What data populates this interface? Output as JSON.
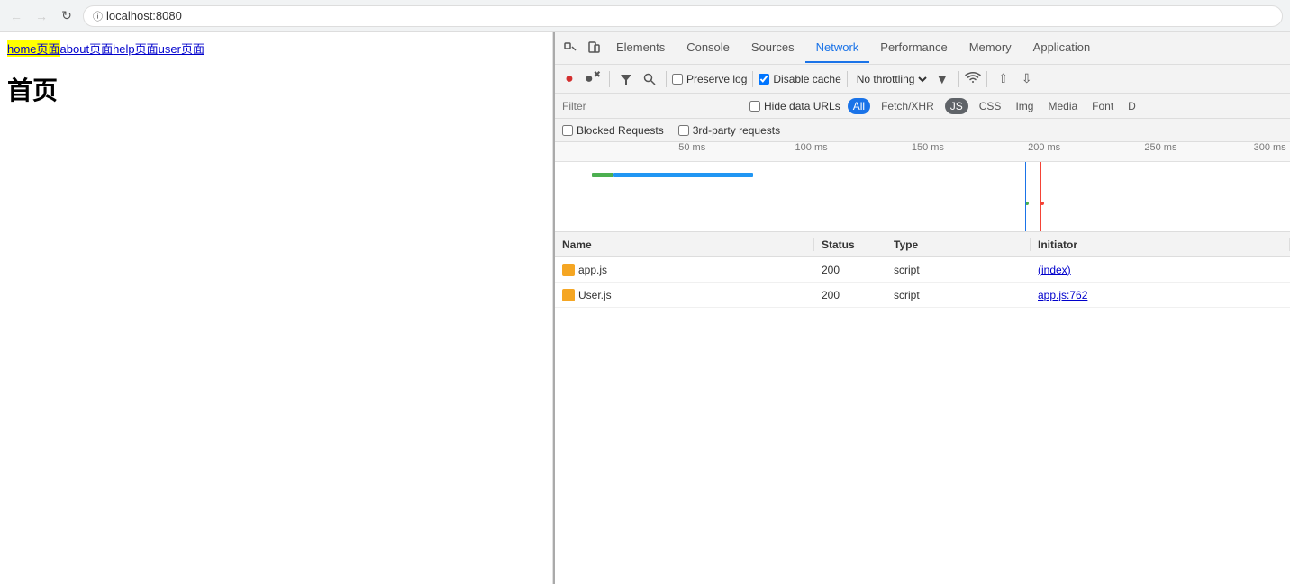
{
  "browser": {
    "address": "localhost:8080"
  },
  "page": {
    "nav_links": [
      {
        "label": "home页面",
        "highlighted": true
      },
      {
        "label": "about页面",
        "highlighted": false
      },
      {
        "label": "help页面",
        "highlighted": false
      },
      {
        "label": "user页面",
        "highlighted": false
      }
    ],
    "heading": "首页"
  },
  "devtools": {
    "tabs": [
      {
        "label": "Elements",
        "active": false
      },
      {
        "label": "Console",
        "active": false
      },
      {
        "label": "Sources",
        "active": false
      },
      {
        "label": "Network",
        "active": true
      },
      {
        "label": "Performance",
        "active": false
      },
      {
        "label": "Memory",
        "active": false
      },
      {
        "label": "Application",
        "active": false
      }
    ],
    "toolbar": {
      "preserve_log": "Preserve log",
      "disable_cache": "Disable cache",
      "throttle": "No throttling"
    },
    "filter": {
      "placeholder": "Filter",
      "hide_data_urls": "Hide data URLs",
      "types": [
        "All",
        "Fetch/XHR",
        "JS",
        "CSS",
        "Img",
        "Media",
        "Font",
        "D"
      ]
    },
    "blocked": {
      "blocked_requests": "Blocked Requests",
      "third_party": "3rd-party requests"
    },
    "timeline": {
      "marks": [
        "50 ms",
        "100 ms",
        "150 ms",
        "200 ms",
        "250 ms",
        "300 ms"
      ]
    },
    "table": {
      "headers": [
        "Name",
        "Status",
        "Type",
        "Initiator"
      ],
      "rows": [
        {
          "name": "app.js",
          "status": "200",
          "type": "script",
          "initiator": "(index)",
          "initiator_link": true
        },
        {
          "name": "User.js",
          "status": "200",
          "type": "script",
          "initiator": "app.js:762",
          "initiator_link": true
        }
      ]
    }
  }
}
